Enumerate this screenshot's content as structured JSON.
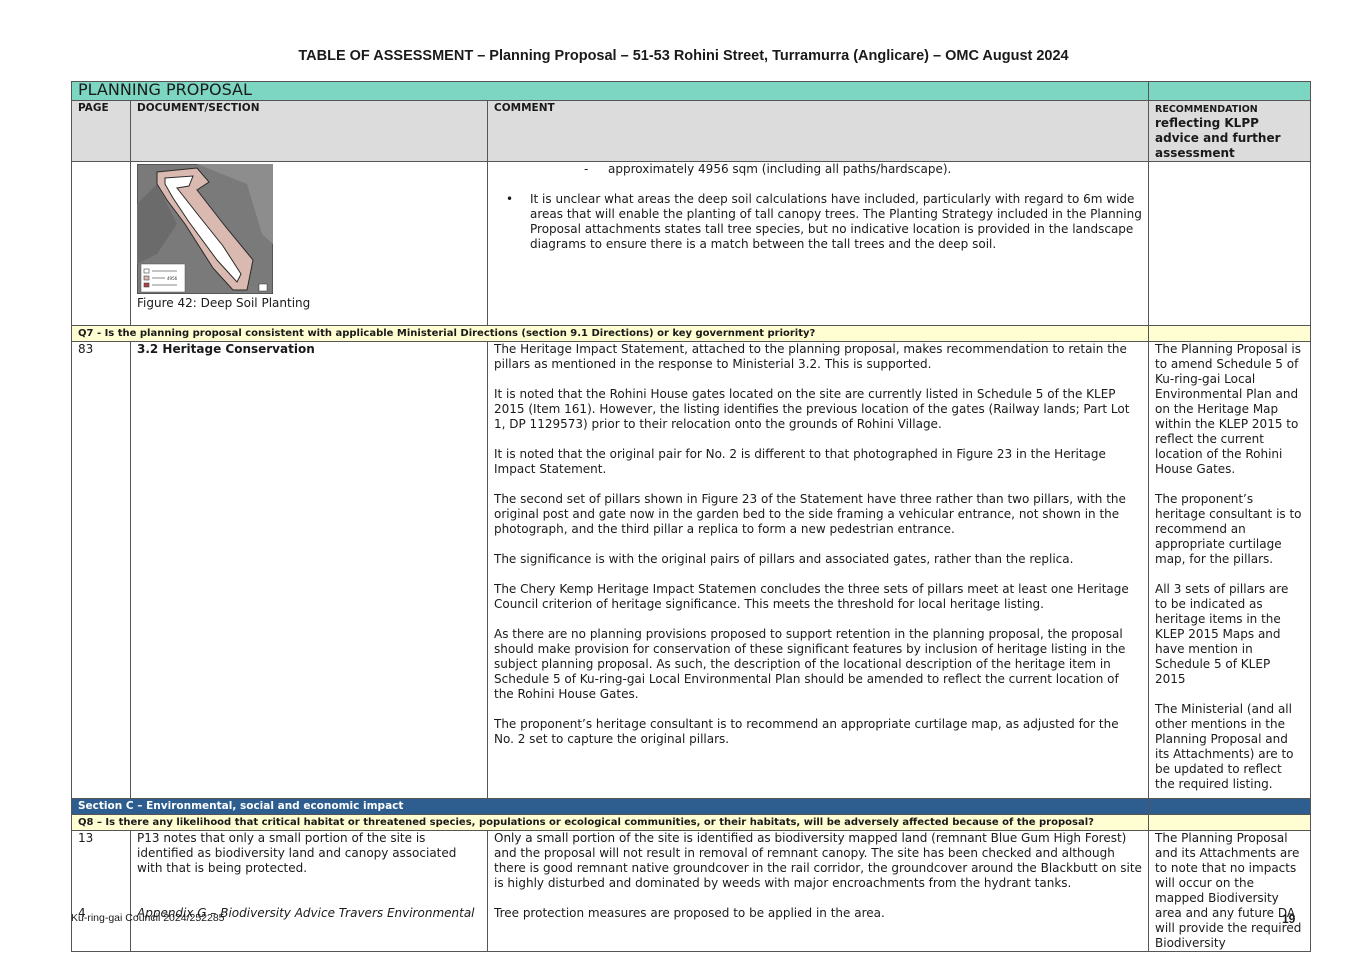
{
  "title": "TABLE OF ASSESSMENT – Planning Proposal – 51-53 Rohini Street, Turramurra (Anglicare) – OMC August 2024",
  "table": {
    "banner": "PLANNING PROPOSAL",
    "headers": {
      "page": "PAGE",
      "document": "DOCUMENT/SECTION",
      "comment": "COMMENT",
      "rec_small": "RECOMMENDATION",
      "rec_big": "reflecting KLPP advice and further assessment"
    },
    "row1": {
      "figure_caption": "Figure 42:  Deep Soil Planting",
      "figure_legend_value": "4956",
      "dash_text": "approximately 4956 sqm (including all paths/hardscape).",
      "bullet_text": "It is unclear what areas the deep soil calculations have included, particularly with regard to 6m wide areas that will enable the planting of tall canopy trees. The Planting Strategy included in the Planning Proposal attachments states tall tree species, but no indicative location is provided in the landscape diagrams to ensure there is a match between the tall trees and the deep soil."
    },
    "q7": "Q7 - Is the planning proposal consistent with applicable Ministerial Directions (section 9.1 Directions) or key government priority?",
    "row2": {
      "page": "83",
      "section": "3.2 Heritage Conservation",
      "comments": [
        "The Heritage Impact Statement, attached to the planning proposal, makes recommendation to retain the pillars as mentioned in the response to Ministerial 3.2. This is supported.",
        "It is noted that the Rohini House gates located on the site are currently listed in Schedule 5 of the KLEP 2015  (Item 161). However, the listing identifies the previous location of the gates (Railway lands; Part Lot 1, DP 1129573) prior to their relocation onto the grounds of Rohini Village.",
        "It is noted that the original pair for No. 2 is different to that photographed in Figure 23 in the Heritage Impact Statement.",
        "The second set of pillars shown in Figure 23 of the Statement have three rather than two pillars, with the original post and gate now in the garden bed to the side framing a vehicular entrance, not shown in the photograph, and the third pillar a replica to form a new pedestrian entrance.",
        "The significance is with the original pairs of pillars and associated gates, rather than the replica.",
        "The Chery Kemp Heritage Impact Statemen concludes the three sets of pillars meet at least one Heritage Council criterion of heritage significance. This meets the threshold for local heritage listing.",
        "As there are no planning provisions proposed to support retention in the planning proposal, the proposal should make provision for conservation of these significant features by inclusion of heritage listing in the subject planning proposal. As such, the description of the locational description of the heritage item in Schedule 5 of Ku-ring-gai Local Environmental Plan should be amended to reflect the current location of the Rohini House Gates.",
        "The proponent’s heritage consultant is to recommend an appropriate curtilage map, as adjusted for the No. 2 set to capture the original pillars."
      ],
      "recommendations": [
        "The Planning Proposal is to amend Schedule 5 of Ku-ring-gai Local Environmental Plan and on the Heritage Map within the KLEP 2015 to reflect the current location of the Rohini House Gates.",
        "The proponent’s heritage consultant is to recommend an appropriate curtilage map, for the pillars.",
        "All 3 sets of pillars are to be indicated as heritage items in the KLEP 2015 Maps and have mention in Schedule 5 of KLEP 2015",
        "The Ministerial (and all other mentions in the Planning Proposal and its Attachments) are to be updated to reflect the required listing."
      ]
    },
    "section_c": "Section C – Environmental, social and economic impact",
    "q8": "Q8 – Is there any likelihood that critical habitat or threatened species, populations or ecological communities, or their habitats, will be adversely affected because of the proposal?",
    "row3": {
      "page_a": "13",
      "page_b": "4",
      "doc_a": "P13 notes that only a small portion of the site is identified as biodiversity land and canopy associated with that is being protected.",
      "doc_b": "Appendix G – Biodiversity Advice Travers Environmental",
      "comments": [
        "Only a small portion of the site is identified as biodiversity mapped land (remnant Blue Gum High Forest) and the proposal will not result in removal of remnant canopy. The site has been checked and although there is good remnant native groundcover in the rail corridor, the groundcover around the Blackbutt on site is highly disturbed and dominated by weeds with major encroachments from the hydrant tanks.",
        "Tree protection measures are proposed to be applied in the area."
      ],
      "recommendation": "The Planning Proposal and its Attachments are to note that no impacts will occur on the mapped Biodiversity area and any future DA will provide the required Biodiversity"
    }
  },
  "footer": {
    "left": "Ku-ring-gai Council 2024/252285",
    "page_number": "19"
  },
  "colors": {
    "banner": "#7dd6c1",
    "header_grey": "#dcdcdc",
    "question_yellow": "#fffed2",
    "section_blue": "#2e5e8f"
  }
}
